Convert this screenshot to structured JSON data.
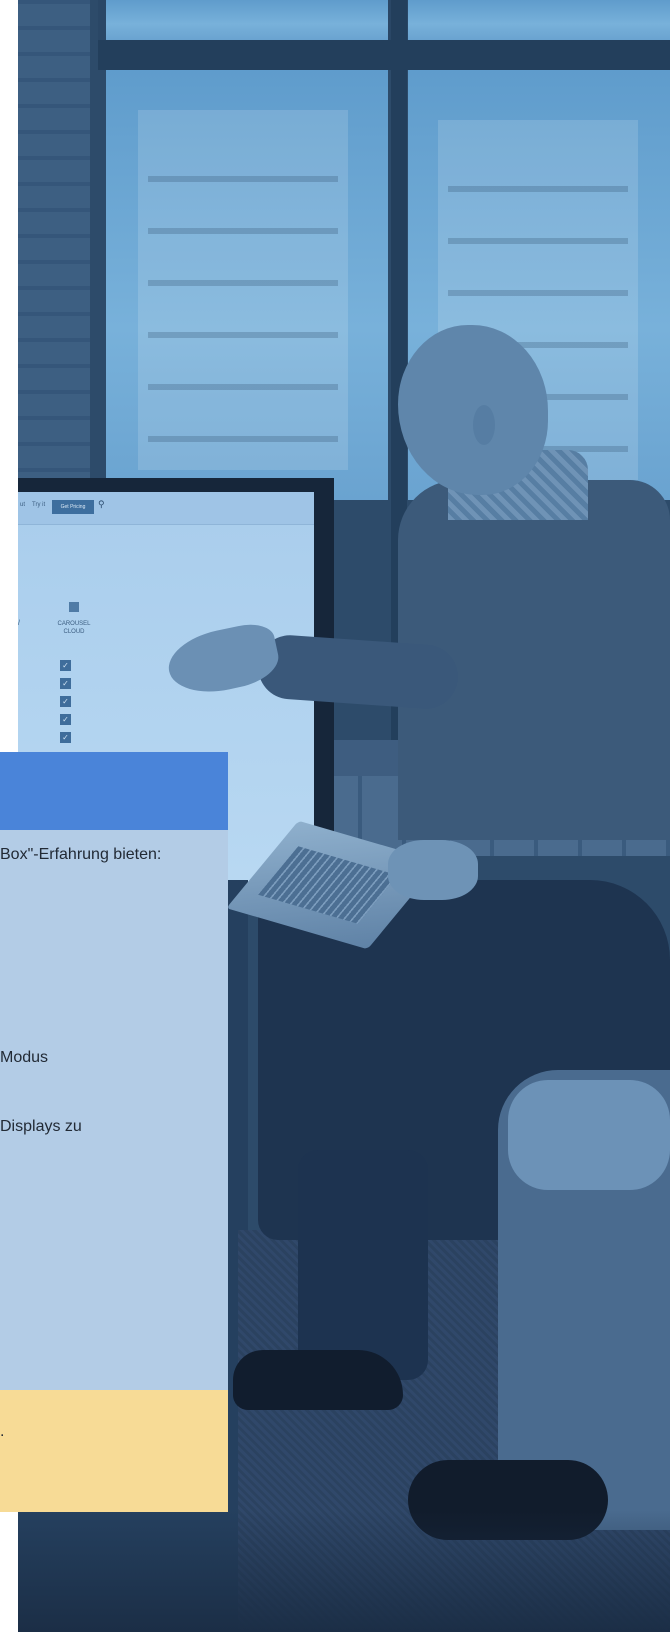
{
  "screen_ui": {
    "nav_items": [
      "ut",
      "Try it"
    ],
    "button_label": "Get Pricing",
    "column_slash": "/",
    "column_label": "CAROUSEL CLOUD",
    "checkmark": "✓",
    "search_glyph": "⚲"
  },
  "card": {
    "intro_text": "Box\"-Erfahrung bieten:",
    "item_1": "Modus",
    "item_2": "Displays zu",
    "note_text": "."
  },
  "colors": {
    "card_header": "#4a84d9",
    "card_body": "#b3cce6",
    "card_note": "#f7db96",
    "photo_tint": "#2d4b6a"
  }
}
